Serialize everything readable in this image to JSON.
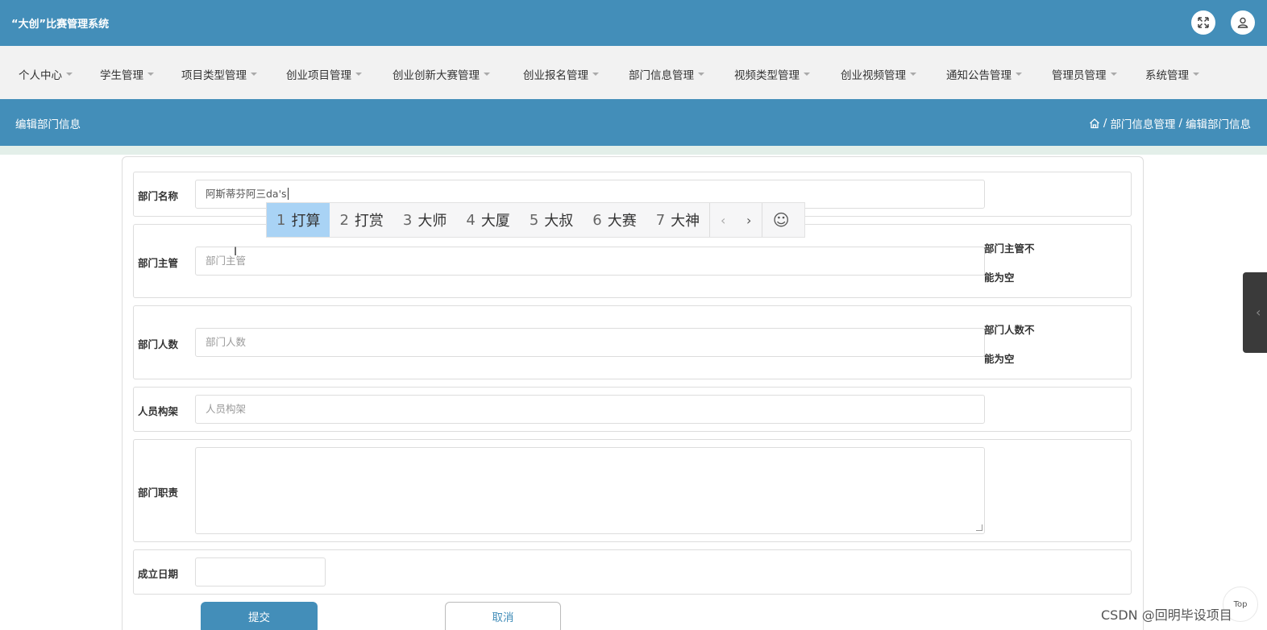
{
  "app": {
    "title": "“大创”比赛管理系统"
  },
  "topbar": {
    "fullscreen_icon": "expand-icon",
    "user_icon": "user-icon"
  },
  "menu": {
    "items": [
      {
        "label": "个人中心"
      },
      {
        "label": "学生管理"
      },
      {
        "label": "项目类型管理"
      },
      {
        "label": "创业项目管理"
      },
      {
        "label": "创业创新大赛管理"
      },
      {
        "label": "创业报名管理"
      },
      {
        "label": "部门信息管理"
      },
      {
        "label": "视频类型管理"
      },
      {
        "label": "创业视频管理"
      },
      {
        "label": "通知公告管理"
      },
      {
        "label": "管理员管理"
      },
      {
        "label": "系统管理"
      }
    ]
  },
  "header": {
    "page_title": "编辑部门信息",
    "breadcrumb": {
      "sep1": "/",
      "crumb1": "部门信息管理",
      "sep2": "/",
      "crumb2": "编辑部门信息"
    }
  },
  "form": {
    "name": {
      "label": "部门名称",
      "value": "阿斯蒂芬阿三da's"
    },
    "manager": {
      "label": "部门主管",
      "placeholder": "部门主管",
      "error_line1": "部门主管不",
      "error_line2": "能为空"
    },
    "count": {
      "label": "部门人数",
      "placeholder": "部门人数",
      "error_line1": "部门人数不",
      "error_line2": "能为空"
    },
    "structure": {
      "label": "人员构架",
      "placeholder": "人员构架"
    },
    "duty": {
      "label": "部门职责",
      "value": ""
    },
    "date": {
      "label": "成立日期",
      "value": ""
    },
    "submit_label": "提交",
    "cancel_label": "取消"
  },
  "ime": {
    "candidates": [
      {
        "num": "1",
        "text": "打算"
      },
      {
        "num": "2",
        "text": "打赏"
      },
      {
        "num": "3",
        "text": "大师"
      },
      {
        "num": "4",
        "text": "大厦"
      },
      {
        "num": "5",
        "text": "大叔"
      },
      {
        "num": "6",
        "text": "大赛"
      },
      {
        "num": "7",
        "text": "大神"
      }
    ],
    "prev": "‹",
    "next": "›",
    "emoji": "☺"
  },
  "overlay": {
    "top_label": "Top",
    "watermark": "CSDN @回明毕设项目",
    "side_tab_glyph": "‹"
  },
  "colors": {
    "brand": "#438eb9",
    "menu_bg": "#f2f2f2",
    "ime_active": "#a9d3f5"
  }
}
